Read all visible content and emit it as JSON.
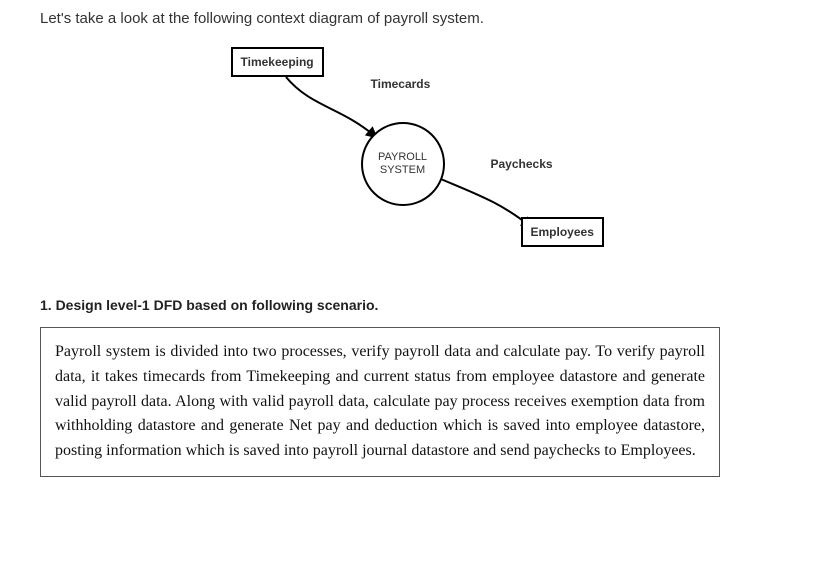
{
  "intro_text": "Let's take a look at the following context diagram of payroll system.",
  "diagram": {
    "timekeeping_label": "Timekeeping",
    "process_label": "PAYROLL\nSYSTEM",
    "employees_label": "Employees",
    "flow_timecards": "Timecards",
    "flow_paychecks": "Paychecks"
  },
  "question_heading": "1. Design level-1 DFD based on following scenario.",
  "scenario_text": "Payroll system is divided into two processes, verify payroll data and calculate pay. To verify payroll data, it takes timecards from Timekeeping and current status from employee datastore and generate valid payroll data. Along with valid payroll data, calculate pay process receives exemption data from withholding datastore and generate Net pay and deduction which is saved into employee datastore, posting information which is saved into payroll journal datastore and send paychecks to Employees."
}
